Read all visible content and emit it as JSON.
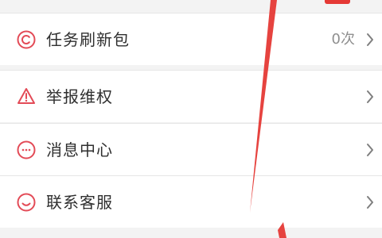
{
  "colors": {
    "accent": "#e34b57",
    "annotation": "#e53935",
    "text": "#2f2f2f",
    "muted": "#8f8f8f",
    "chevron": "#7f7f7f",
    "background": "#f3f3f3",
    "row_background": "#ffffff"
  },
  "menu": {
    "items": [
      {
        "icon": "coin-icon",
        "label": "任务刷新包",
        "value": "0次",
        "chevron": "chevron-right-icon"
      },
      {
        "icon": "warning-icon",
        "label": "举报维权",
        "value": "",
        "chevron": "chevron-right-icon"
      },
      {
        "icon": "message-icon",
        "label": "消息中心",
        "value": "",
        "chevron": "chevron-right-icon"
      },
      {
        "icon": "customer-service-icon",
        "label": "联系客服",
        "value": "",
        "chevron": "chevron-right-icon"
      }
    ]
  }
}
